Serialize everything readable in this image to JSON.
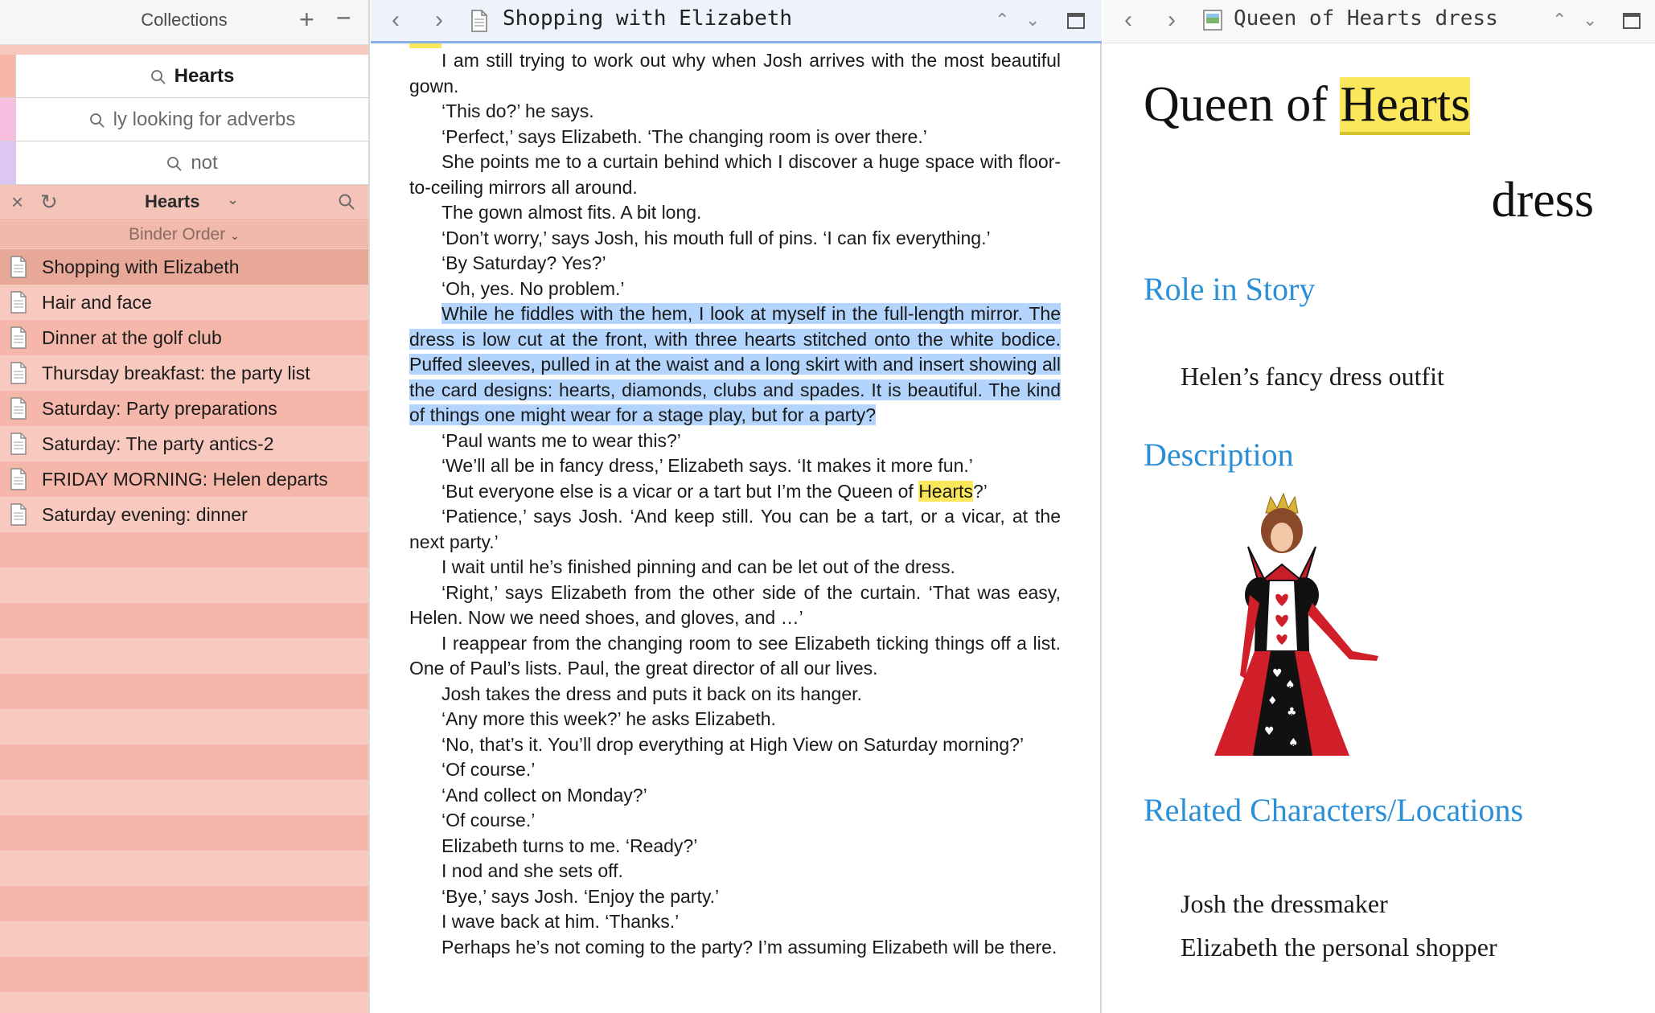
{
  "collections": {
    "title": "Collections",
    "add_label": "+",
    "remove_label": "−"
  },
  "search_tabs": [
    {
      "label": "Hearts",
      "active": true,
      "color": "#f6b7a6"
    },
    {
      "label": "ly looking for adverbs",
      "active": false,
      "color": "#f9bfe0"
    },
    {
      "label": "not",
      "active": false,
      "color": "#dcc6f3"
    }
  ],
  "active_collection": {
    "close_label": "×",
    "redo_label": "↻",
    "title": "Hearts",
    "chevron": "⌄"
  },
  "binder_order": {
    "label": "Binder Order",
    "chevron": "⌄"
  },
  "documents": [
    {
      "label": "Shopping with Elizabeth",
      "selected": true
    },
    {
      "label": "Hair and face",
      "selected": false
    },
    {
      "label": "Dinner at the golf club",
      "selected": false
    },
    {
      "label": "Thursday breakfast: the party list",
      "selected": false
    },
    {
      "label": "Saturday: Party preparations",
      "selected": false
    },
    {
      "label": "Saturday: The party antics-2",
      "selected": false
    },
    {
      "label": "FRIDAY MORNING: Helen departs",
      "selected": false
    },
    {
      "label": "Saturday evening: dinner",
      "selected": false
    }
  ],
  "editor": {
    "back": "‹",
    "forward": "›",
    "title": "Shopping with Elizabeth",
    "up": "⌃",
    "down": "⌄",
    "body": [
      "I am still trying to work out why when Josh arrives with the most beautiful gown.",
      "‘This do?’ he says.",
      "‘Perfect,’ says Elizabeth. ‘The changing room is over there.’",
      "She points me to a curtain behind which I discover a huge space with floor-to-ceiling mirrors all around.",
      "The gown almost fits. A bit long.",
      "‘Don’t worry,’ says Josh, his mouth full of pins. ‘I can fix everything.’",
      "‘By Saturday? Yes?’",
      "‘Oh, yes. No problem.’",
      "While he fiddles with the hem, I look at myself in the full-length mirror. The dress is low cut at the front, with three hearts stitched onto the white bodice. Puffed sleeves, pulled in at the waist and a long skirt with and insert showing all the card designs: hearts, diamonds, clubs and spades. It is beautiful. The kind of things one might wear for a stage play, but for a party?",
      "‘Paul wants me to wear this?’",
      "‘We’ll all be in fancy dress,’ Elizabeth says. ‘It makes it more fun.’",
      "‘But everyone else is a vicar or a tart but I’m the Queen of |Hearts|?’",
      "‘Patience,’ says Josh. ‘And keep still. You can be a tart, or a vicar, at the next party.’",
      "I wait until he’s finished pinning and can be let out of the dress.",
      "‘Right,’ says Elizabeth from the other side of the curtain. ‘That was easy, Helen. Now we need shoes, and gloves, and …’",
      "I reappear from the changing room to see Elizabeth ticking things off a list. One of Paul’s lists. Paul, the great director of all our lives.",
      "Josh takes the dress and puts it back on its hanger.",
      "‘Any more this week?’ he asks Elizabeth.",
      "‘No, that’s it. You’ll drop everything at High View on Saturday morning?’",
      "‘Of course.’",
      "‘And collect on Monday?’",
      "‘Of course.’",
      "Elizabeth turns to me. ‘Ready?’",
      "I nod and she sets off.",
      "‘Bye,’ says Josh. ‘Enjoy the party.’",
      "I wave back at him. ‘Thanks.’",
      "Perhaps he’s not coming to the party? I’m assuming Elizabeth will be there."
    ],
    "selected_paragraph_index": 8
  },
  "preview": {
    "back": "‹",
    "forward": "›",
    "title": "Queen of Hearts dress",
    "up": "⌃",
    "down": "⌄",
    "heading_prefix": "Queen of ",
    "heading_highlight": "Hearts",
    "heading_suffix": "dress",
    "role_heading": "Role in Story",
    "role_text": "Helen’s fancy dress outfit",
    "description_heading": "Description",
    "related_heading": "Related Characters/Locations",
    "related": [
      "Josh the dressmaker",
      "Elizabeth the personal shopper"
    ]
  },
  "colors": {
    "sidebar_bg": "#f7cabf",
    "selection": "#b3d4fc",
    "highlight": "#fbe75b",
    "heading_blue": "#2a8fd6"
  }
}
